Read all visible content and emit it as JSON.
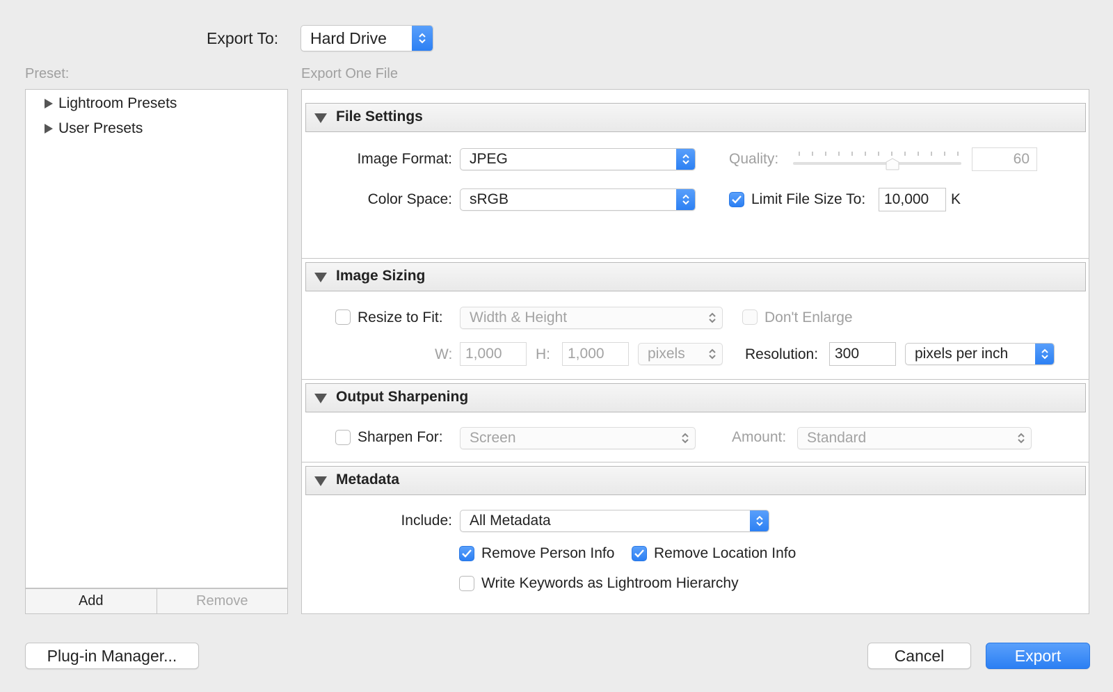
{
  "header": {
    "export_to_label": "Export To:",
    "export_to_value": "Hard Drive"
  },
  "preset": {
    "label": "Preset:",
    "items": [
      {
        "label": "Lightroom Presets"
      },
      {
        "label": "User Presets"
      }
    ],
    "add_label": "Add",
    "remove_label": "Remove"
  },
  "export_summary": "Export One File",
  "file_settings": {
    "title": "File Settings",
    "image_format_label": "Image Format:",
    "image_format_value": "JPEG",
    "quality_label": "Quality:",
    "quality_value": "60",
    "quality_level": 0.6,
    "color_space_label": "Color Space:",
    "color_space_value": "sRGB",
    "limit_file_size_label": "Limit File Size To:",
    "limit_file_size_value": "10,000",
    "limit_file_size_unit": "K",
    "limit_file_size_checked": true
  },
  "image_sizing": {
    "title": "Image Sizing",
    "resize_label": "Resize to Fit:",
    "resize_checked": false,
    "resize_mode": "Width & Height",
    "dont_enlarge_label": "Don't Enlarge",
    "w_label": "W:",
    "w_value": "1,000",
    "h_label": "H:",
    "h_value": "1,000",
    "units_value": "pixels",
    "resolution_label": "Resolution:",
    "resolution_value": "300",
    "resolution_units": "pixels per inch"
  },
  "output_sharpening": {
    "title": "Output Sharpening",
    "sharpen_label": "Sharpen For:",
    "sharpen_checked": false,
    "sharpen_value": "Screen",
    "amount_label": "Amount:",
    "amount_value": "Standard"
  },
  "metadata": {
    "title": "Metadata",
    "include_label": "Include:",
    "include_value": "All Metadata",
    "remove_person_label": "Remove Person Info",
    "remove_person_checked": true,
    "remove_location_label": "Remove Location Info",
    "remove_location_checked": true,
    "write_keywords_label": "Write Keywords as Lightroom Hierarchy",
    "write_keywords_checked": false
  },
  "footer": {
    "plugin_manager_label": "Plug-in Manager...",
    "cancel_label": "Cancel",
    "export_label": "Export"
  },
  "colors": {
    "accent": "#2b7ff3",
    "background": "#ececec"
  }
}
